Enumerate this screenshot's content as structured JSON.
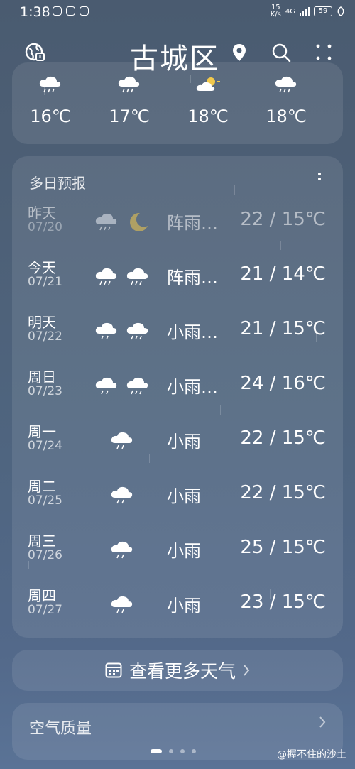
{
  "status_bar": {
    "time": "1:38",
    "net_speed_value": "15",
    "net_speed_unit": "K/s",
    "network": "4G",
    "battery": "59"
  },
  "header": {
    "city": "古城区"
  },
  "hourly": [
    {
      "icon": "rain-cloud-icon",
      "temp": "16℃"
    },
    {
      "icon": "rain-cloud-icon",
      "temp": "17℃"
    },
    {
      "icon": "partly-sunny-icon",
      "temp": "18℃"
    },
    {
      "icon": "rain-cloud-icon",
      "temp": "18℃"
    }
  ],
  "forecast": {
    "title": "多日预报",
    "days": [
      {
        "day": "昨天",
        "date": "07/20",
        "day_icon": "rain-cloud-icon",
        "night_icon": "moon-icon",
        "condition": "阵雨…",
        "temp": "22 / 15℃"
      },
      {
        "day": "今天",
        "date": "07/21",
        "day_icon": "rain-cloud-icon",
        "night_icon": "rain-cloud-icon",
        "condition": "阵雨…",
        "temp": "21 / 14℃"
      },
      {
        "day": "明天",
        "date": "07/22",
        "day_icon": "rain-cloud-icon",
        "night_icon": "rain-cloud-icon",
        "condition": "小雨…",
        "temp": "21 / 15℃"
      },
      {
        "day": "周日",
        "date": "07/23",
        "day_icon": "rain-cloud-icon",
        "night_icon": "rain-cloud-icon",
        "condition": "小雨…",
        "temp": "24 / 16℃"
      },
      {
        "day": "周一",
        "date": "07/24",
        "day_icon": "rain-cloud-icon",
        "condition": "小雨",
        "temp": "22 / 15℃"
      },
      {
        "day": "周二",
        "date": "07/25",
        "day_icon": "rain-cloud-icon",
        "condition": "小雨",
        "temp": "22 / 15℃"
      },
      {
        "day": "周三",
        "date": "07/26",
        "day_icon": "rain-cloud-icon",
        "condition": "小雨",
        "temp": "25 / 15℃"
      },
      {
        "day": "周四",
        "date": "07/27",
        "day_icon": "rain-cloud-icon",
        "condition": "小雨",
        "temp": "23 / 15℃"
      }
    ]
  },
  "more_weather": {
    "label": "查看更多天气"
  },
  "air_quality": {
    "label": "空气质量"
  },
  "watermark": "@握不住的沙土"
}
